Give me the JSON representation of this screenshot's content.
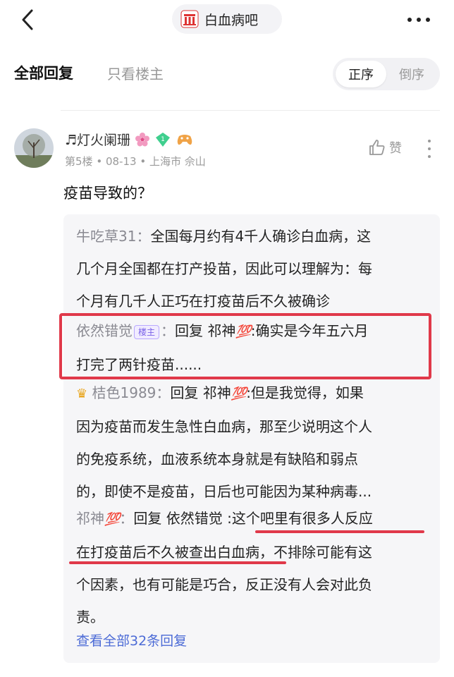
{
  "header": {
    "title": "白血病吧",
    "back_icon": "chevron-left-icon",
    "more_icon": "ellipsis-icon"
  },
  "tabs": {
    "all_replies": "全部回复",
    "op_only": "只看楼主",
    "order_asc": "正序",
    "order_desc": "倒序"
  },
  "post": {
    "username": "♬灯火阑珊",
    "floor": "第5楼",
    "date": "08-13",
    "location": "上海市 佘山",
    "like_label": "赞",
    "content": "疫苗导致的？"
  },
  "replies": [
    {
      "name": "牛吃草31：",
      "line1": "全国每月约有4千人确诊白血病，这",
      "line2": "几个月全国都在打产投苗，因此可以理解为：每",
      "line3": "个月有几千人正巧在打疫苗后不久被确诊"
    },
    {
      "name": "依然错觉",
      "badge": "楼主",
      "colon": "：",
      "prefix": "回复 祁神",
      "emoji": "💯",
      "line1": ":确实是今年五六月",
      "line2": "打完了两针疫苗......"
    },
    {
      "name": "桔色1989：",
      "prefix": "回复 祁神",
      "emoji": "💯",
      "line1": ":但是我觉得，如果",
      "line2": "因为疫苗而发生急性白血病，那至少说明这个人",
      "line3": "的免疫系统，血液系统本身就是有缺陷和弱点",
      "line4": "的，即使不是疫苗，日后也可能因为某种病毒..."
    },
    {
      "name": "祁神",
      "emoji": "💯",
      "colon": "：",
      "prefix": "回复 依然错觉 ",
      "line1": ":这个吧里有很多人反应",
      "line2a": "在打疫苗后不久被查出白血病",
      "line2b": "，不排除可能有这",
      "line3": "个因素，也有可能是巧合，反正没有人会对此负",
      "line4": "责。"
    }
  ],
  "view_all": "查看全部32条回复",
  "colors": {
    "annotation_red": "#e0394a",
    "link_blue": "#4c6bd6"
  }
}
